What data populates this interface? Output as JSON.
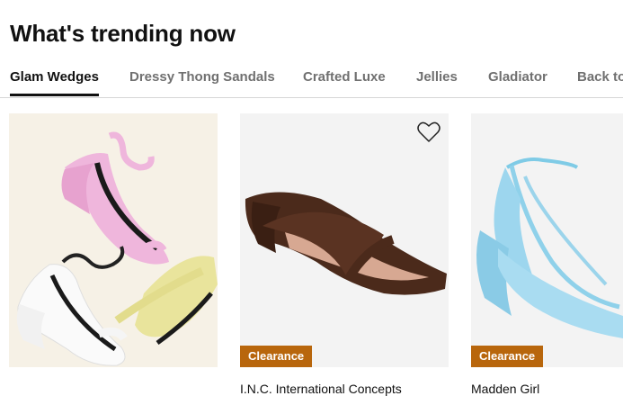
{
  "section": {
    "title": "What's trending now"
  },
  "tabs": [
    {
      "label": "Glam Wedges",
      "active": true
    },
    {
      "label": "Dressy Thong Sandals",
      "active": false
    },
    {
      "label": "Crafted Luxe",
      "active": false
    },
    {
      "label": "Jellies",
      "active": false
    },
    {
      "label": "Gladiator",
      "active": false
    },
    {
      "label": "Back to",
      "active": false
    }
  ],
  "products": [
    {
      "name": "",
      "badge": "",
      "image": "pastel-wedge-sandals-photo"
    },
    {
      "name": "I.N.C. International Concepts",
      "badge": "Clearance",
      "image": "brown-thong-wedge-sandal"
    },
    {
      "name": "Madden Girl",
      "badge": "Clearance",
      "image": "light-blue-ankle-strap-wedge"
    }
  ],
  "colors": {
    "clearance_badge": "#b8660c",
    "active_tab": "#111111",
    "inactive_tab": "#707070"
  }
}
